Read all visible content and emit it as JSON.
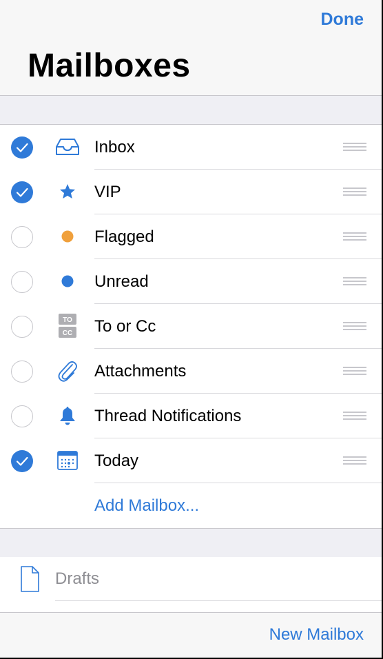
{
  "header": {
    "done_label": "Done",
    "title": "Mailboxes"
  },
  "colors": {
    "accent": "#2f7ad8",
    "flag": "#f0a03c",
    "separator": "#c8c7cc"
  },
  "mailboxes": [
    {
      "label": "Inbox",
      "checked": true,
      "icon": "inbox-tray-icon"
    },
    {
      "label": "VIP",
      "checked": true,
      "icon": "star-icon"
    },
    {
      "label": "Flagged",
      "checked": false,
      "icon": "orange-dot-icon"
    },
    {
      "label": "Unread",
      "checked": false,
      "icon": "blue-dot-icon"
    },
    {
      "label": "To or Cc",
      "checked": false,
      "icon": "to-cc-icon",
      "icon_text": [
        "TO",
        "CC"
      ]
    },
    {
      "label": "Attachments",
      "checked": false,
      "icon": "paperclip-icon"
    },
    {
      "label": "Thread Notifications",
      "checked": false,
      "icon": "bell-icon"
    },
    {
      "label": "Today",
      "checked": true,
      "icon": "calendar-icon"
    }
  ],
  "add_mailbox_label": "Add Mailbox...",
  "drafts": {
    "label": "Drafts",
    "icon": "document-icon"
  },
  "toolbar": {
    "new_mailbox_label": "New Mailbox"
  }
}
